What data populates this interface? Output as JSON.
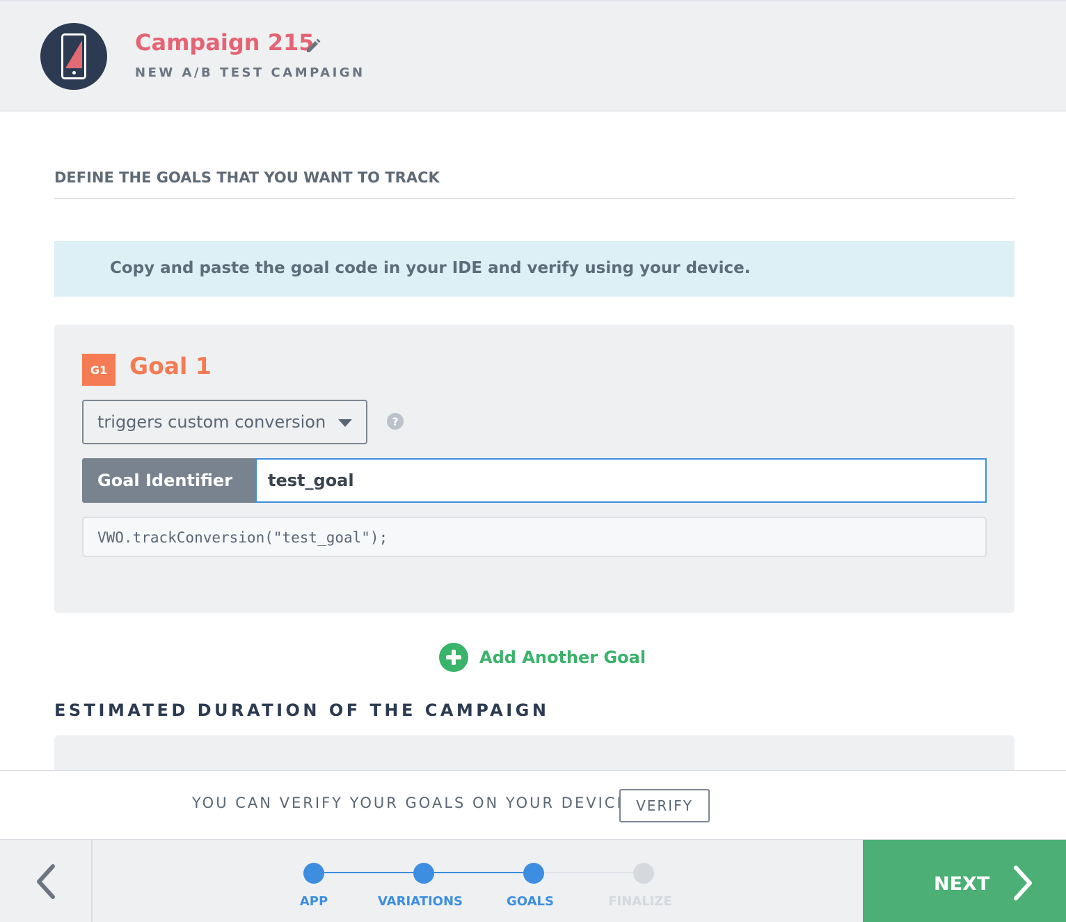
{
  "header": {
    "campaign_title": "Campaign 215",
    "campaign_subtitle": "NEW A/B TEST CAMPAIGN",
    "icons": {
      "app": "smartphone-icon",
      "edit": "pencil-icon"
    }
  },
  "goals_section": {
    "heading": "DEFINE THE GOALS THAT YOU WANT TO TRACK",
    "info_banner": "Copy and paste the goal code in your IDE and verify using your device."
  },
  "goal": {
    "badge": "G1",
    "title": "Goal 1",
    "type_selected": "triggers custom conversion",
    "identifier_label": "Goal Identifier",
    "identifier_value": "test_goal",
    "code_snippet": "VWO.trackConversion(\"test_goal\");",
    "help_icon": "?"
  },
  "add_goal_label": "Add Another Goal",
  "duration_heading": "ESTIMATED DURATION OF THE CAMPAIGN",
  "verify": {
    "text": "YOU CAN VERIFY YOUR GOALS ON YOUR DEVICE",
    "button_label": "VERIFY"
  },
  "stepper": {
    "steps": [
      {
        "label": "APP",
        "state": "done"
      },
      {
        "label": "VARIATIONS",
        "state": "done"
      },
      {
        "label": "GOALS",
        "state": "current"
      },
      {
        "label": "FINALIZE",
        "state": "pending"
      }
    ],
    "next_label": "NEXT"
  },
  "colors": {
    "accent_blue": "#3d8ee0",
    "green": "#4caf76",
    "goal_orange": "#f47b53",
    "title_pink": "#e46474",
    "pending_gray": "#d5d9de"
  }
}
